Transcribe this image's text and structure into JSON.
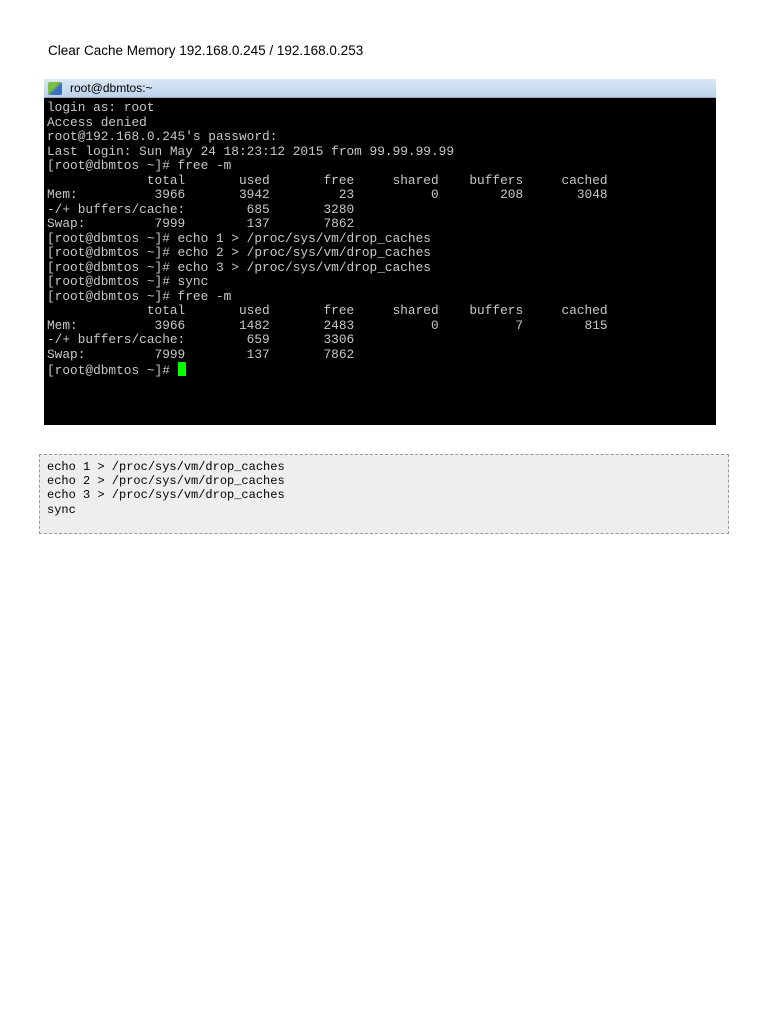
{
  "page_title": "Clear Cache Memory 192.168.0.245 / 192.168.0.253",
  "window": {
    "title": "root@dbmtos:~"
  },
  "terminal_lines": [
    "login as: root",
    "Access denied",
    "root@192.168.0.245's password:",
    "Last login: Sun May 24 18:23:12 2015 from 99.99.99.99",
    "[root@dbmtos ~]# free -m",
    "             total       used       free     shared    buffers     cached",
    "Mem:          3966       3942         23          0        208       3048",
    "-/+ buffers/cache:        685       3280",
    "Swap:         7999        137       7862",
    "[root@dbmtos ~]# echo 1 > /proc/sys/vm/drop_caches",
    "[root@dbmtos ~]# echo 2 > /proc/sys/vm/drop_caches",
    "[root@dbmtos ~]# echo 3 > /proc/sys/vm/drop_caches",
    "[root@dbmtos ~]# sync",
    "[root@dbmtos ~]# free -m",
    "             total       used       free     shared    buffers     cached",
    "Mem:          3966       1482       2483          0          7        815",
    "-/+ buffers/cache:        659       3306",
    "Swap:         7999        137       7862"
  ],
  "prompt": "[root@dbmtos ~]# ",
  "code_lines": [
    "echo 1 > /proc/sys/vm/drop_caches",
    "echo 2 > /proc/sys/vm/drop_caches",
    "echo 3 > /proc/sys/vm/drop_caches",
    "sync"
  ],
  "colors": {
    "cursor": "#00ff00",
    "terminal_bg": "#000000"
  }
}
